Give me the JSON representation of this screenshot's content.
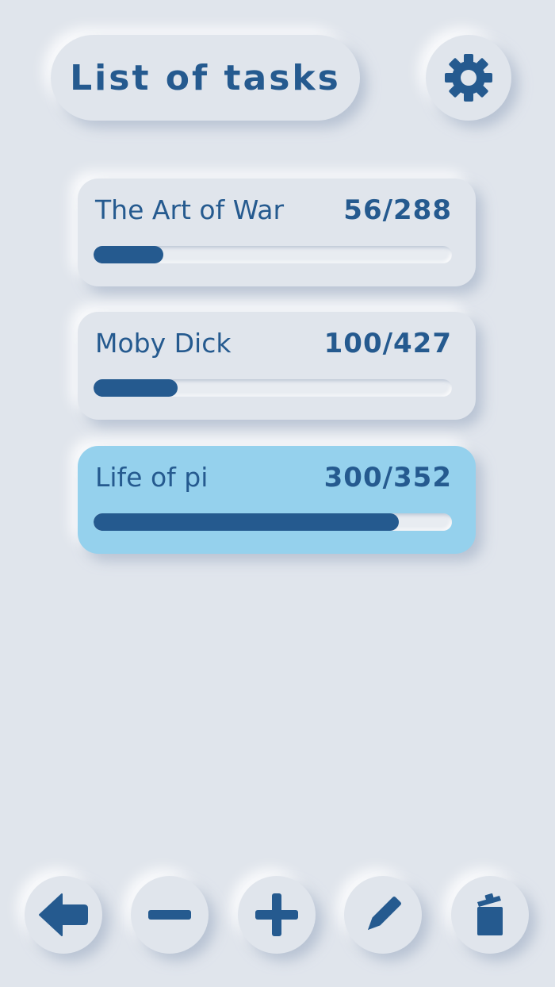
{
  "header": {
    "title": "List of tasks",
    "settings_icon": "gear-icon"
  },
  "tasks": [
    {
      "name": "The Art of War",
      "count": "56/288",
      "progress": 0.194,
      "active": false
    },
    {
      "name": "Moby Dick",
      "count": "100/427",
      "progress": 0.234,
      "active": false
    },
    {
      "name": "Life of pi",
      "count": "300/352",
      "progress": 0.852,
      "active": true
    }
  ],
  "toolbar": {
    "icons": [
      "back-arrow-icon",
      "minus-icon",
      "plus-icon",
      "pencil-icon",
      "trash-icon"
    ]
  },
  "colors": {
    "background": "#e0e5ec",
    "accent": "#255a8f",
    "active_card": "#95d1ed"
  }
}
